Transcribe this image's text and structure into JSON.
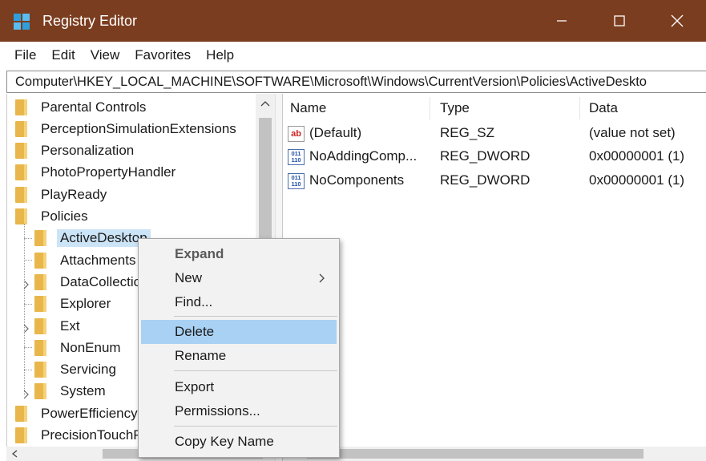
{
  "window": {
    "title": "Registry Editor",
    "controls": [
      "minimize",
      "maximize",
      "close"
    ]
  },
  "menu": [
    "File",
    "Edit",
    "View",
    "Favorites",
    "Help"
  ],
  "address": "Computer\\HKEY_LOCAL_MACHINE\\SOFTWARE\\Microsoft\\Windows\\CurrentVersion\\Policies\\ActiveDeskto",
  "tree": {
    "items": [
      {
        "label": "Parental Controls",
        "level": 0
      },
      {
        "label": "PerceptionSimulationExtensions",
        "level": 0
      },
      {
        "label": "Personalization",
        "level": 0
      },
      {
        "label": "PhotoPropertyHandler",
        "level": 0
      },
      {
        "label": "PlayReady",
        "level": 0
      },
      {
        "label": "Policies",
        "level": 0
      },
      {
        "label": "ActiveDesktop",
        "level": 1,
        "selected": true
      },
      {
        "label": "Attachments",
        "level": 1
      },
      {
        "label": "DataCollection",
        "level": 1,
        "expandable": true
      },
      {
        "label": "Explorer",
        "level": 1
      },
      {
        "label": "Ext",
        "level": 1,
        "expandable": true
      },
      {
        "label": "NonEnum",
        "level": 1
      },
      {
        "label": "Servicing",
        "level": 1
      },
      {
        "label": "System",
        "level": 1,
        "expandable": true
      },
      {
        "label": "PowerEfficiencyDiagnostics",
        "level": 0
      },
      {
        "label": "PrecisionTouchPad",
        "level": 0
      }
    ]
  },
  "values_pane": {
    "columns": [
      "Name",
      "Type",
      "Data"
    ],
    "rows": [
      {
        "name": "(Default)",
        "type": "REG_SZ",
        "data": "(value not set)",
        "icon": "string-value-icon"
      },
      {
        "name": "NoAddingComp...",
        "type": "REG_DWORD",
        "data": "0x00000001 (1)",
        "icon": "binary-value-icon"
      },
      {
        "name": "NoComponents",
        "type": "REG_DWORD",
        "data": "0x00000001 (1)",
        "icon": "binary-value-icon"
      }
    ]
  },
  "context_menu": {
    "items": [
      {
        "label": "Expand",
        "bold": true
      },
      {
        "label": "New",
        "submenu": true
      },
      {
        "label": "Find..."
      },
      {
        "separator": true
      },
      {
        "label": "Delete",
        "highlighted": true
      },
      {
        "label": "Rename"
      },
      {
        "separator": true
      },
      {
        "label": "Export"
      },
      {
        "label": "Permissions..."
      },
      {
        "separator": true
      },
      {
        "label": "Copy Key Name"
      }
    ]
  },
  "colors": {
    "titlebar": "#7b3d1f",
    "selection": "#cce4f7",
    "menu_highlight": "#a9d1f3",
    "folder": "#e8b64b"
  }
}
